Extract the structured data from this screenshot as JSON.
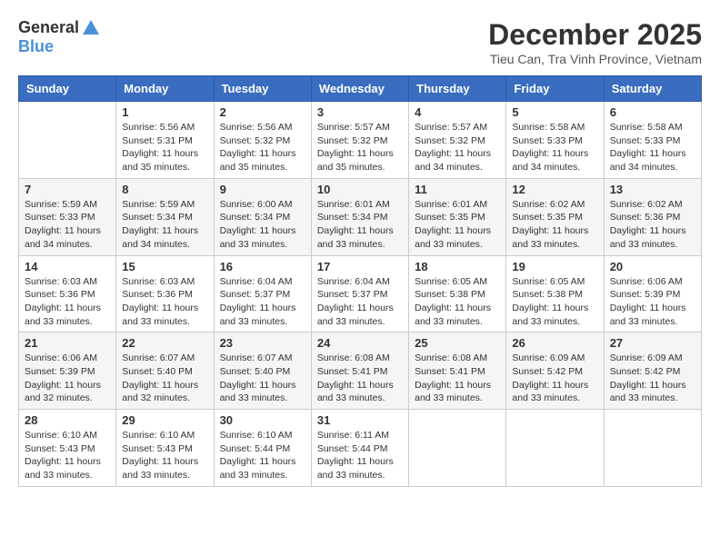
{
  "header": {
    "logo_general": "General",
    "logo_blue": "Blue",
    "title": "December 2025",
    "subtitle": "Tieu Can, Tra Vinh Province, Vietnam"
  },
  "days_of_week": [
    "Sunday",
    "Monday",
    "Tuesday",
    "Wednesday",
    "Thursday",
    "Friday",
    "Saturday"
  ],
  "weeks": [
    [
      {
        "day": "",
        "sunrise": "",
        "sunset": "",
        "daylight": ""
      },
      {
        "day": "1",
        "sunrise": "Sunrise: 5:56 AM",
        "sunset": "Sunset: 5:31 PM",
        "daylight": "Daylight: 11 hours and 35 minutes."
      },
      {
        "day": "2",
        "sunrise": "Sunrise: 5:56 AM",
        "sunset": "Sunset: 5:32 PM",
        "daylight": "Daylight: 11 hours and 35 minutes."
      },
      {
        "day": "3",
        "sunrise": "Sunrise: 5:57 AM",
        "sunset": "Sunset: 5:32 PM",
        "daylight": "Daylight: 11 hours and 35 minutes."
      },
      {
        "day": "4",
        "sunrise": "Sunrise: 5:57 AM",
        "sunset": "Sunset: 5:32 PM",
        "daylight": "Daylight: 11 hours and 34 minutes."
      },
      {
        "day": "5",
        "sunrise": "Sunrise: 5:58 AM",
        "sunset": "Sunset: 5:33 PM",
        "daylight": "Daylight: 11 hours and 34 minutes."
      },
      {
        "day": "6",
        "sunrise": "Sunrise: 5:58 AM",
        "sunset": "Sunset: 5:33 PM",
        "daylight": "Daylight: 11 hours and 34 minutes."
      }
    ],
    [
      {
        "day": "7",
        "sunrise": "Sunrise: 5:59 AM",
        "sunset": "Sunset: 5:33 PM",
        "daylight": "Daylight: 11 hours and 34 minutes."
      },
      {
        "day": "8",
        "sunrise": "Sunrise: 5:59 AM",
        "sunset": "Sunset: 5:34 PM",
        "daylight": "Daylight: 11 hours and 34 minutes."
      },
      {
        "day": "9",
        "sunrise": "Sunrise: 6:00 AM",
        "sunset": "Sunset: 5:34 PM",
        "daylight": "Daylight: 11 hours and 33 minutes."
      },
      {
        "day": "10",
        "sunrise": "Sunrise: 6:01 AM",
        "sunset": "Sunset: 5:34 PM",
        "daylight": "Daylight: 11 hours and 33 minutes."
      },
      {
        "day": "11",
        "sunrise": "Sunrise: 6:01 AM",
        "sunset": "Sunset: 5:35 PM",
        "daylight": "Daylight: 11 hours and 33 minutes."
      },
      {
        "day": "12",
        "sunrise": "Sunrise: 6:02 AM",
        "sunset": "Sunset: 5:35 PM",
        "daylight": "Daylight: 11 hours and 33 minutes."
      },
      {
        "day": "13",
        "sunrise": "Sunrise: 6:02 AM",
        "sunset": "Sunset: 5:36 PM",
        "daylight": "Daylight: 11 hours and 33 minutes."
      }
    ],
    [
      {
        "day": "14",
        "sunrise": "Sunrise: 6:03 AM",
        "sunset": "Sunset: 5:36 PM",
        "daylight": "Daylight: 11 hours and 33 minutes."
      },
      {
        "day": "15",
        "sunrise": "Sunrise: 6:03 AM",
        "sunset": "Sunset: 5:36 PM",
        "daylight": "Daylight: 11 hours and 33 minutes."
      },
      {
        "day": "16",
        "sunrise": "Sunrise: 6:04 AM",
        "sunset": "Sunset: 5:37 PM",
        "daylight": "Daylight: 11 hours and 33 minutes."
      },
      {
        "day": "17",
        "sunrise": "Sunrise: 6:04 AM",
        "sunset": "Sunset: 5:37 PM",
        "daylight": "Daylight: 11 hours and 33 minutes."
      },
      {
        "day": "18",
        "sunrise": "Sunrise: 6:05 AM",
        "sunset": "Sunset: 5:38 PM",
        "daylight": "Daylight: 11 hours and 33 minutes."
      },
      {
        "day": "19",
        "sunrise": "Sunrise: 6:05 AM",
        "sunset": "Sunset: 5:38 PM",
        "daylight": "Daylight: 11 hours and 33 minutes."
      },
      {
        "day": "20",
        "sunrise": "Sunrise: 6:06 AM",
        "sunset": "Sunset: 5:39 PM",
        "daylight": "Daylight: 11 hours and 33 minutes."
      }
    ],
    [
      {
        "day": "21",
        "sunrise": "Sunrise: 6:06 AM",
        "sunset": "Sunset: 5:39 PM",
        "daylight": "Daylight: 11 hours and 32 minutes."
      },
      {
        "day": "22",
        "sunrise": "Sunrise: 6:07 AM",
        "sunset": "Sunset: 5:40 PM",
        "daylight": "Daylight: 11 hours and 32 minutes."
      },
      {
        "day": "23",
        "sunrise": "Sunrise: 6:07 AM",
        "sunset": "Sunset: 5:40 PM",
        "daylight": "Daylight: 11 hours and 33 minutes."
      },
      {
        "day": "24",
        "sunrise": "Sunrise: 6:08 AM",
        "sunset": "Sunset: 5:41 PM",
        "daylight": "Daylight: 11 hours and 33 minutes."
      },
      {
        "day": "25",
        "sunrise": "Sunrise: 6:08 AM",
        "sunset": "Sunset: 5:41 PM",
        "daylight": "Daylight: 11 hours and 33 minutes."
      },
      {
        "day": "26",
        "sunrise": "Sunrise: 6:09 AM",
        "sunset": "Sunset: 5:42 PM",
        "daylight": "Daylight: 11 hours and 33 minutes."
      },
      {
        "day": "27",
        "sunrise": "Sunrise: 6:09 AM",
        "sunset": "Sunset: 5:42 PM",
        "daylight": "Daylight: 11 hours and 33 minutes."
      }
    ],
    [
      {
        "day": "28",
        "sunrise": "Sunrise: 6:10 AM",
        "sunset": "Sunset: 5:43 PM",
        "daylight": "Daylight: 11 hours and 33 minutes."
      },
      {
        "day": "29",
        "sunrise": "Sunrise: 6:10 AM",
        "sunset": "Sunset: 5:43 PM",
        "daylight": "Daylight: 11 hours and 33 minutes."
      },
      {
        "day": "30",
        "sunrise": "Sunrise: 6:10 AM",
        "sunset": "Sunset: 5:44 PM",
        "daylight": "Daylight: 11 hours and 33 minutes."
      },
      {
        "day": "31",
        "sunrise": "Sunrise: 6:11 AM",
        "sunset": "Sunset: 5:44 PM",
        "daylight": "Daylight: 11 hours and 33 minutes."
      },
      {
        "day": "",
        "sunrise": "",
        "sunset": "",
        "daylight": ""
      },
      {
        "day": "",
        "sunrise": "",
        "sunset": "",
        "daylight": ""
      },
      {
        "day": "",
        "sunrise": "",
        "sunset": "",
        "daylight": ""
      }
    ]
  ]
}
